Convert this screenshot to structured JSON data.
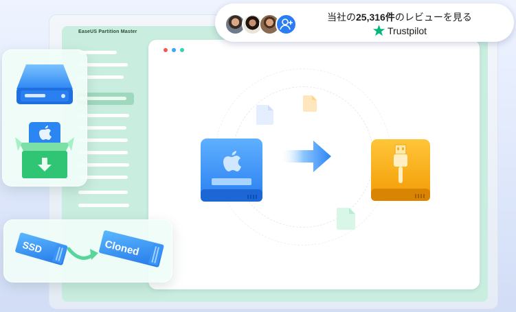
{
  "app": {
    "title": "EaseUS Partition Master"
  },
  "review_badge": {
    "prefix": "当社の",
    "count": "25,316件",
    "suffix": "のレビューを見る",
    "trustpilot_label": "Trustpilot"
  },
  "ssd_card": {
    "source_label": "SSD",
    "target_label": "Cloned"
  },
  "colors": {
    "accent_green": "#00b67a",
    "mint_panel": "#c9eddf",
    "mac_drive_blue": "#2f86f2",
    "usb_drive_orange": "#f5a60b",
    "avatar_add_blue": "#2b7df3"
  },
  "icons": [
    "hard-drive-icon",
    "apple-box-icon",
    "mac-drive-icon",
    "transfer-arrow-icon",
    "usb-drive-icon",
    "user-plus-icon",
    "star-icon",
    "file-icon"
  ]
}
